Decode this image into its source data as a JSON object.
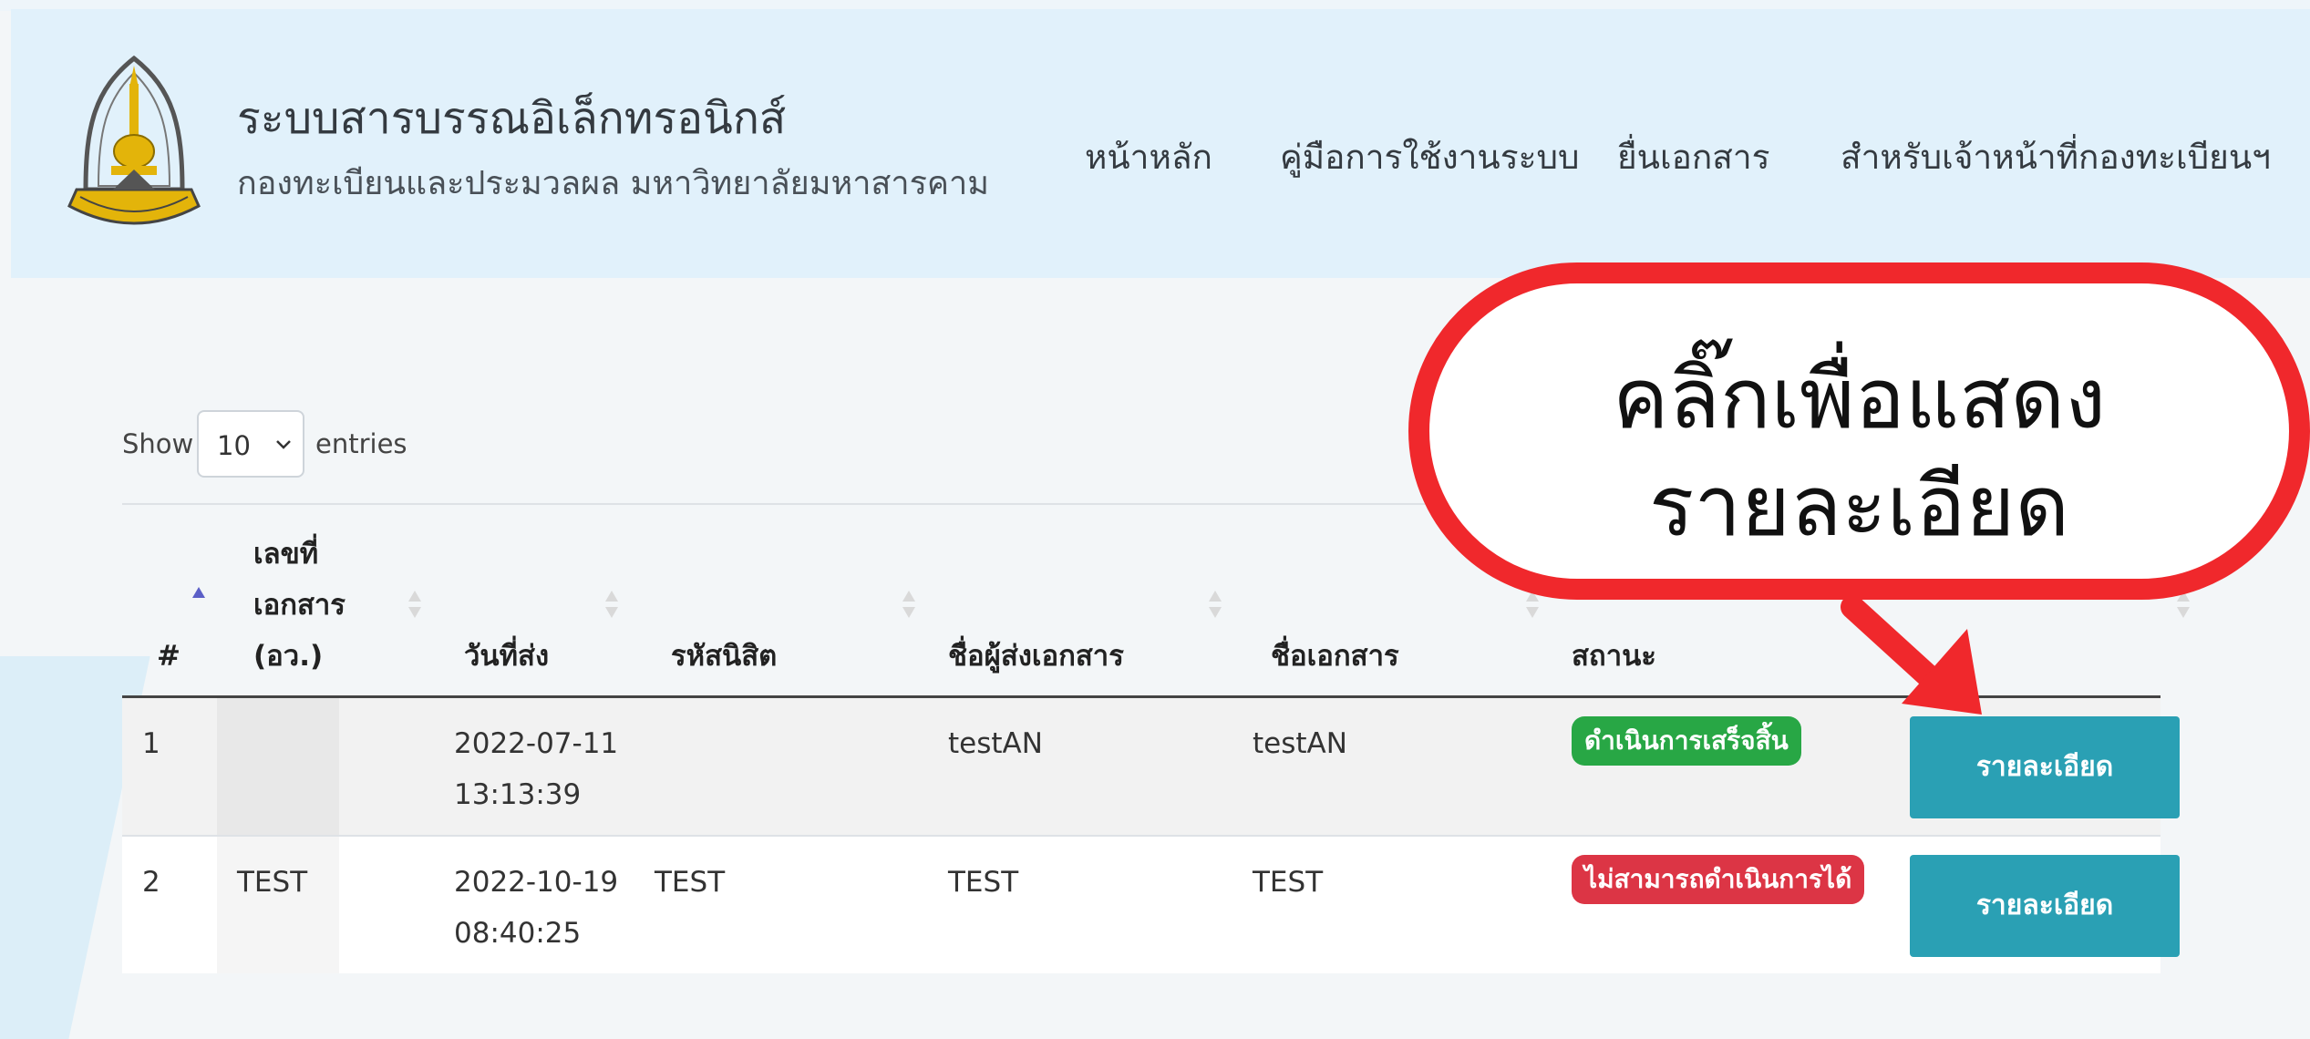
{
  "header": {
    "title": "ระบบสารบรรณอิเล็กทรอนิกส์",
    "subtitle": "กองทะเบียนและประมวลผล มหาวิทยาลัยมหาสารคาม",
    "nav": [
      "หน้าหลัก",
      "คู่มือการใช้งานระบบ",
      "ยื่นเอกสาร",
      "สำหรับเจ้าหน้าที่กองทะเบียนฯ"
    ]
  },
  "length_menu": {
    "show": "Show",
    "value": "10",
    "entries": "entries"
  },
  "table": {
    "columns": [
      "#",
      "เลขที่",
      "เอกสาร",
      "(อว.)",
      "วันที่ส่ง",
      "รหัสนิสิต",
      "ชื่อผู้ส่งเอกสาร",
      "ชื่อเอกสาร",
      "สถานะ"
    ],
    "rows": [
      {
        "no": "1",
        "doc_no": "",
        "date": "2022-07-11",
        "time": "13:13:39",
        "student_id": "",
        "sender": "testAN",
        "doc_name": "testAN",
        "status": "ดำเนินการเสร็จสิ้น",
        "status_color": "#28a745",
        "action": "รายละเอียด"
      },
      {
        "no": "2",
        "doc_no": "TEST",
        "date": "2022-10-19",
        "time": "08:40:25",
        "student_id": "TEST",
        "sender": "TEST",
        "doc_name": "TEST",
        "status": "ไม่สามารถดำเนินการได้",
        "status_color": "#dc3545",
        "action": "รายละเอียด"
      }
    ]
  },
  "callout": {
    "line1": "คลิ๊กเพื่อแสดง",
    "line2": "รายละเอียด",
    "color": "#f0282c"
  },
  "colors": {
    "header_bg": "#e1f1fb",
    "button": "#2aa0b4"
  },
  "icons": {
    "logo": "university-seal-logo",
    "select": "chevron-down-icon",
    "sort": "sort-icon",
    "arrow": "arrow-annotation"
  }
}
